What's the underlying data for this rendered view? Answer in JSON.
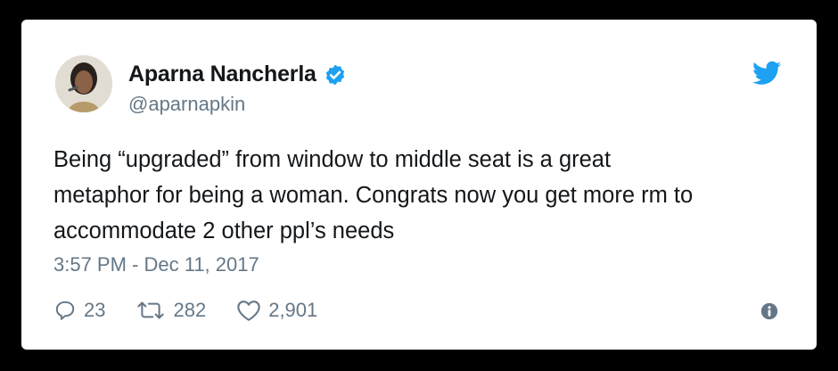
{
  "tweet": {
    "author_name": "Aparna Nancherla",
    "author_handle": "@aparnapkin",
    "verified_icon": "verified-badge-icon",
    "platform_icon": "twitter-bird-icon",
    "text": "Being “upgraded” from window to middle seat is a great\nmetaphor for being a woman. Congrats now you get more rm to\naccommodate 2 other ppl’s needs",
    "timestamp": "3:57 PM - Dec 11, 2017"
  },
  "actions": {
    "replies": {
      "icon": "reply-icon",
      "count": "23"
    },
    "retweets": {
      "icon": "retweet-icon",
      "count": "282"
    },
    "likes": {
      "icon": "heart-icon",
      "count": "2,901"
    },
    "info": {
      "icon": "info-icon"
    }
  },
  "colors": {
    "twitter_blue": "#1da1f2",
    "text_primary": "#14171a",
    "text_secondary": "#657786",
    "background_outer": "#000000",
    "card_background": "#ffffff"
  }
}
